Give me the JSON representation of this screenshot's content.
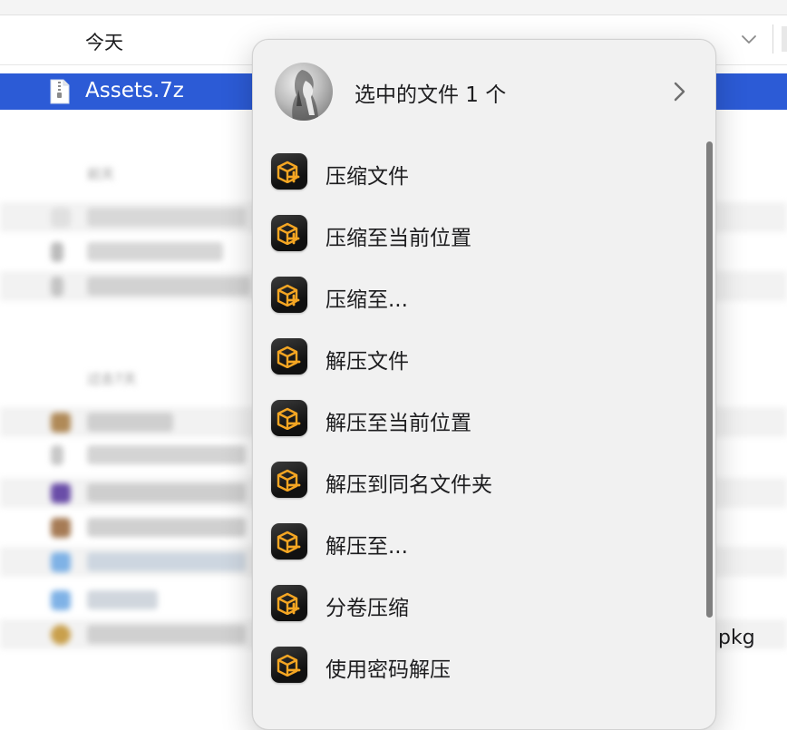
{
  "finder": {
    "group_header": "今天",
    "selected_file": "Assets.7z",
    "visible_suffix": "pkg",
    "colors": {
      "selection": "#2c5bd6"
    }
  },
  "menu": {
    "header": {
      "title": "选中的文件 1 个",
      "avatar": "user-avatar-icon",
      "arrow": "chevron-right-icon"
    },
    "items": [
      {
        "label": "压缩文件",
        "icon": "compress-icon"
      },
      {
        "label": "压缩至当前位置",
        "icon": "compress-icon"
      },
      {
        "label": "压缩至...",
        "icon": "compress-icon"
      },
      {
        "label": "解压文件",
        "icon": "extract-icon"
      },
      {
        "label": "解压至当前位置",
        "icon": "extract-icon"
      },
      {
        "label": "解压到同名文件夹",
        "icon": "extract-icon"
      },
      {
        "label": "解压至...",
        "icon": "extract-icon"
      },
      {
        "label": "分卷压缩",
        "icon": "compress-icon"
      },
      {
        "label": "使用密码解压",
        "icon": "extract-icon"
      }
    ],
    "colors": {
      "icon_accent": "#f5a623",
      "icon_bg": "#1a1a1a"
    }
  }
}
